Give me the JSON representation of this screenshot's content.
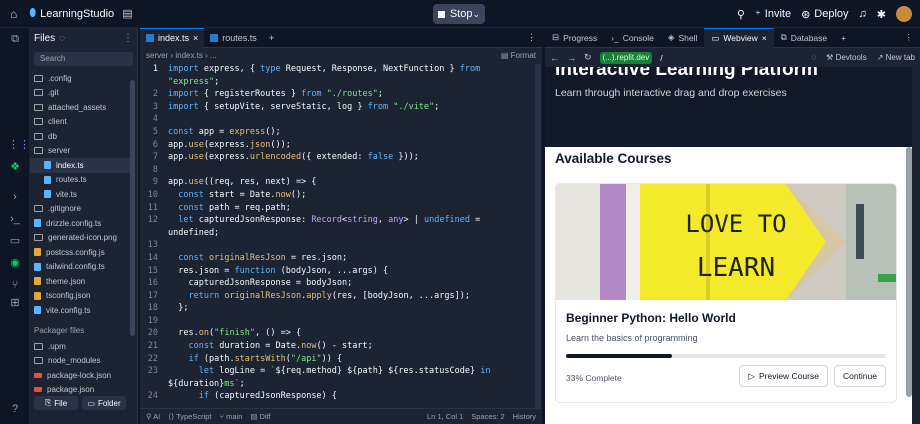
{
  "topbar": {
    "project_name": "LearningStudio",
    "stop_label": "Stop",
    "invite_label": "Invite",
    "deploy_label": "Deploy"
  },
  "files": {
    "title": "Files",
    "search_placeholder": "Search",
    "tree": [
      {
        "name": ".config",
        "kind": "folder"
      },
      {
        "name": ".git",
        "kind": "folder"
      },
      {
        "name": "attached_assets",
        "kind": "folder"
      },
      {
        "name": "client",
        "kind": "folder"
      },
      {
        "name": "db",
        "kind": "folder"
      },
      {
        "name": "server",
        "kind": "folder"
      },
      {
        "name": "index.ts",
        "kind": "ts",
        "selected": true
      },
      {
        "name": "routes.ts",
        "kind": "ts"
      },
      {
        "name": "vite.ts",
        "kind": "ts"
      },
      {
        "name": ".gitignore",
        "kind": "file"
      },
      {
        "name": "drizzle.config.ts",
        "kind": "ts"
      },
      {
        "name": "generated-icon.png",
        "kind": "img"
      },
      {
        "name": "postcss.config.js",
        "kind": "js"
      },
      {
        "name": "tailwind.config.ts",
        "kind": "ts"
      },
      {
        "name": "theme.json",
        "kind": "json"
      },
      {
        "name": "tsconfig.json",
        "kind": "json"
      },
      {
        "name": "vite.config.ts",
        "kind": "ts"
      }
    ],
    "packager_label": "Packager files",
    "packager": [
      {
        "name": ".upm",
        "kind": "folder"
      },
      {
        "name": "node_modules",
        "kind": "folder"
      },
      {
        "name": "package-lock.json",
        "kind": "lock"
      },
      {
        "name": "package.json",
        "kind": "lock"
      }
    ],
    "new_file_label": "File",
    "new_folder_label": "Folder"
  },
  "editor": {
    "tabs": [
      "index.ts",
      "routes.ts"
    ],
    "breadcrumb": "server  ›  index.ts  ›  ...",
    "format_label": "Format",
    "lines": [
      {
        "n": "1",
        "html": "<span class='kw'>import</span> express, { <span class='kw'>type</span> Request, Response, NextFunction } <span class='kw'>from</span>"
      },
      {
        "n": "",
        "html": "<span class='str'>\"express\"</span>;"
      },
      {
        "n": "2",
        "html": "<span class='kw'>import</span> { registerRoutes } <span class='kw'>from</span> <span class='str'>\"./routes\"</span>;"
      },
      {
        "n": "3",
        "html": "<span class='kw'>import</span> { setupVite, serveStatic, log } <span class='kw'>from</span> <span class='str'>\"./vite\"</span>;"
      },
      {
        "n": "4",
        "html": ""
      },
      {
        "n": "5",
        "html": "<span class='kw'>const</span> app = <span class='fn'>express</span>();"
      },
      {
        "n": "6",
        "html": "app.<span class='fn'>use</span>(express.<span class='fn'>json</span>());"
      },
      {
        "n": "7",
        "html": "app.<span class='fn'>use</span>(express.<span class='fn'>urlencoded</span>({ extended: <span class='kw'>false</span> }));"
      },
      {
        "n": "8",
        "html": ""
      },
      {
        "n": "9",
        "html": "app.<span class='fn'>use</span>((req, res, next) => {"
      },
      {
        "n": "10",
        "html": "  <span class='kw'>const</span> start = Date.<span class='fn'>now</span>();"
      },
      {
        "n": "11",
        "html": "  <span class='kw'>const</span> path = req.path;"
      },
      {
        "n": "12",
        "html": "  <span class='kw'>let</span> capturedJsonResponse: <span class='ty'>Record</span>&lt;<span class='ty'>string</span>, <span class='ty'>any</span>&gt; | <span class='kw'>undefined</span> ="
      },
      {
        "n": "",
        "html": "undefined;"
      },
      {
        "n": "13",
        "html": ""
      },
      {
        "n": "14",
        "html": "  <span class='kw'>const</span> <span class='fn'>originalResJson</span> = res.json;"
      },
      {
        "n": "15",
        "html": "  res.json = <span class='kw'>function</span> (bodyJson, ...args) {"
      },
      {
        "n": "16",
        "html": "    capturedJsonResponse = bodyJson;"
      },
      {
        "n": "17",
        "html": "    <span class='kw'>return</span> <span class='fn'>originalResJson</span>.<span class='fn'>apply</span>(res, [bodyJson, ...args]);"
      },
      {
        "n": "18",
        "html": "  };"
      },
      {
        "n": "19",
        "html": ""
      },
      {
        "n": "20",
        "html": "  res.<span class='fn'>on</span>(<span class='str'>\"finish\"</span>, () => {"
      },
      {
        "n": "21",
        "html": "    <span class='kw'>const</span> duration = Date.<span class='fn'>now</span>() - start;"
      },
      {
        "n": "22",
        "html": "    <span class='kw'>if</span> (path.<span class='fn'>startsWith</span>(<span class='str'>\"/api\"</span>)) {"
      },
      {
        "n": "23",
        "html": "      <span class='kw'>let</span> logLine = <span class='str'>`</span>${req.method} ${path} ${res.statusCode} <span class='kw'>in</span>"
      },
      {
        "n": "",
        "html": "${duration}<span class='str'>ms`</span>;"
      },
      {
        "n": "24",
        "html": "      <span class='kw'>if</span> (capturedJsonResponse) {"
      }
    ],
    "status": {
      "ai": "AI",
      "lang": "TypeScript",
      "branch": "main",
      "diff": "Diff",
      "pos": "Ln 1, Col 1",
      "spaces": "Spaces: 2",
      "history": "History"
    }
  },
  "rightpane": {
    "tabs": [
      "Progress",
      "Console",
      "Shell",
      "Webview",
      "Database"
    ],
    "url_host": "(...).replit.dev",
    "url_path": "/",
    "devtools_label": "Devtools",
    "newtab_label": "New tab",
    "web": {
      "hero_title": "Interactive Learning Platform",
      "hero_sub": "Learn through interactive drag and drop exercises",
      "section_title": "Available Courses",
      "image_text": [
        "LOVE TO",
        "LEARN"
      ],
      "course_title": "Beginner Python: Hello World",
      "course_desc": "Learn the basics of programming",
      "progress_value": 0.33,
      "progress_text": "33% Complete",
      "preview_label": "Preview Course",
      "continue_label": "Continue"
    }
  }
}
